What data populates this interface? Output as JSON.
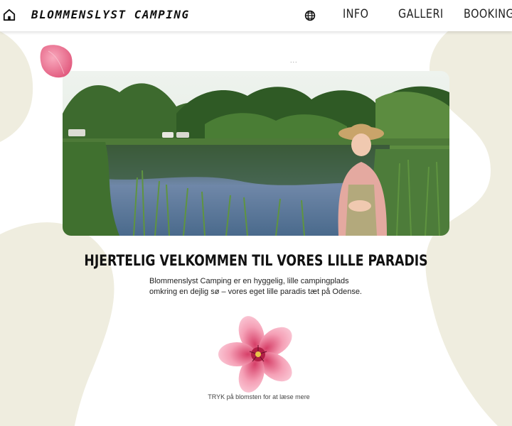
{
  "header": {
    "brand": "BLOMMENSLYST CAMPING",
    "nav": [
      {
        "label": "INFO"
      },
      {
        "label": "GALLERI"
      },
      {
        "label": "BOOKING"
      }
    ]
  },
  "icons": {
    "home": "home-icon",
    "language": "globe-icon",
    "petal": "petal-decoration",
    "flower": "flower-icon"
  },
  "hero": {
    "dots": "..."
  },
  "main": {
    "heading": "HJERTELIG VELKOMMEN TIL VORES LILLE PARADIS",
    "intro": "Blommenslyst Camping er en hyggelig, lille campingplads omkring en dejlig sø – vores eget lille paradis tæt på Odense.",
    "cta": "TRYK på blomsten for at læse mere"
  },
  "colors": {
    "background_blob": "#efeddf",
    "flower_pink": "#f07a9a",
    "text": "#1a1a1a"
  }
}
